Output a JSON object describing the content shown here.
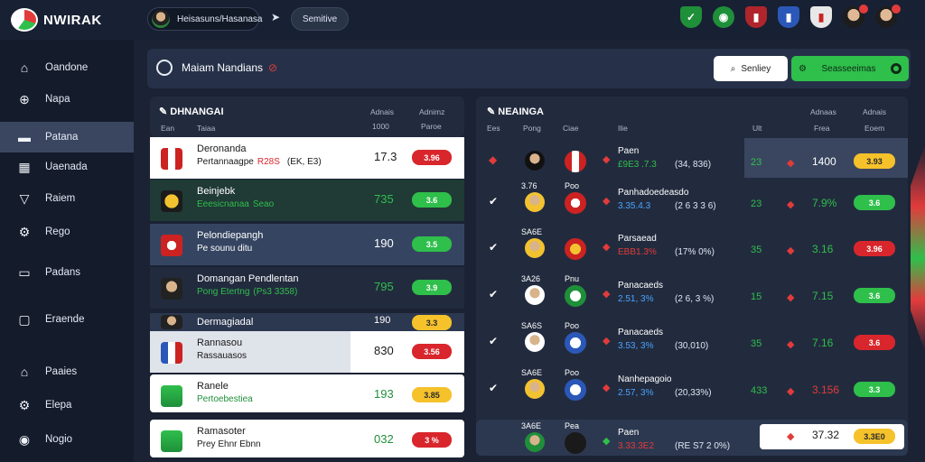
{
  "app": {
    "logo_text": "NWIRAK"
  },
  "topbar": {
    "user_label": "Heisasuns/Hasanasa",
    "service_label": "Semitive",
    "arrow_glyph": "➤"
  },
  "sidebar": {
    "items": [
      {
        "label": "Oandone",
        "icon": "home-icon",
        "glyph": "⌂"
      },
      {
        "label": "Napa",
        "icon": "compass-icon",
        "glyph": "⊕"
      },
      {
        "label": "Patana",
        "icon": "folder-icon",
        "glyph": "▬",
        "active": true
      },
      {
        "label": "Uaenada",
        "icon": "calendar-icon",
        "glyph": "▦"
      },
      {
        "label": "Raiem",
        "icon": "shield-icon",
        "glyph": "▽"
      },
      {
        "label": "Rego",
        "icon": "settings-icon",
        "glyph": "⚙"
      },
      {
        "label": "Padans",
        "icon": "document-icon",
        "glyph": "▭"
      },
      {
        "label": "Eraende",
        "icon": "square-icon",
        "glyph": "▢"
      },
      {
        "label": "Paaies",
        "icon": "house-icon",
        "glyph": "⌂"
      },
      {
        "label": "Elepa",
        "icon": "gear-icon",
        "glyph": "⚙"
      },
      {
        "label": "Nogio",
        "icon": "user-icon",
        "glyph": "◉"
      }
    ]
  },
  "header": {
    "title": "Maiam Nandians",
    "flag": "⊘"
  },
  "actions": {
    "search_label": "Senliey",
    "primary_label": "Seasseeimas"
  },
  "left_panel": {
    "title": "DHNANGAI",
    "columns": [
      "Ean",
      "Taiaa",
      "Adnais",
      "Adnimz",
      "1000",
      "Paroe"
    ],
    "rows": [
      {
        "name": "Deronanda",
        "sub": "Pertannaagpe",
        "sub_red": "R28S",
        "sub_tail": "(EK, E3)",
        "value": "17.3",
        "badge": "3.96",
        "badge_color": "red"
      },
      {
        "name": "Beinjebk",
        "sub": "Eeesicnanaa",
        "sub_tail": "Seao",
        "value": "735",
        "badge": "3.6",
        "badge_color": "green"
      },
      {
        "name": "Pelondiepangh",
        "sub": "Pe sounu ditu",
        "value": "190",
        "badge": "3.5",
        "badge_color": "green"
      },
      {
        "name": "Domangan Pendlentan",
        "sub": "Pong Etertng",
        "sub_tail": "(Ps3 3358)",
        "value": "795",
        "badge": "3.9",
        "badge_color": "green"
      },
      {
        "name": "Dermagiadal",
        "value": "190",
        "badge": "3.3",
        "badge_color": "yellow"
      },
      {
        "name": "Rannasou",
        "sub": "Rassauasos",
        "value": "830",
        "badge": "3.56",
        "badge_color": "red"
      },
      {
        "name": "Ranele",
        "sub": "Pertoebestiea",
        "value": "193",
        "badge": "3.85",
        "badge_color": "yellow"
      },
      {
        "name": "Ramasoter",
        "sub": "Prey Ehnr Ebnn",
        "value": "032",
        "badge": "3 %",
        "badge_color": "red"
      }
    ]
  },
  "right_panel": {
    "title": "NEAINGA",
    "columns": [
      "Ees",
      "Pong",
      "Ciae",
      "Ilie",
      "Ult",
      "Adnaas",
      "Adnais",
      "Frea",
      "Eoem"
    ],
    "rows": [
      {
        "check": "",
        "top": "",
        "crest_top": "",
        "bname": "Paen",
        "bval": "£9E3 .7.3",
        "bpar": "(34, 836)",
        "n1": "23",
        "n2": "1400",
        "badge": "3.93",
        "badge_color": "yellow"
      },
      {
        "check": "✔",
        "top": "3.76",
        "crest_top": "Poo",
        "bname": "Panhadoedeasdo",
        "bval": "3.35.4.3",
        "bpar": "(2 6 3 3 6)",
        "n1": "23",
        "n2": "7.9%",
        "badge": "3.6",
        "badge_color": "green"
      },
      {
        "check": "✔",
        "top": "SA6E",
        "crest_top": "",
        "bname": "Parsaead",
        "bval": "EBB1.3%",
        "bpar": "(17% 0%)",
        "n1": "35",
        "n2": "3.16",
        "badge": "3.96",
        "badge_color": "red"
      },
      {
        "check": "✔",
        "top": "3A26",
        "crest_top": "Pnu",
        "bname": "Panacaeds",
        "bval": "2.51, 3%",
        "bpar": "(2 6, 3 %)",
        "n1": "15",
        "n2": "7.15",
        "badge": "3.6",
        "badge_color": "green"
      },
      {
        "check": "✔",
        "top": "SA6S",
        "crest_top": "Poo",
        "bname": "Panacaeds",
        "bval": "3.53, 3%",
        "bpar": "(30,010)",
        "n1": "35",
        "n2": "7.16",
        "badge": "3.6",
        "badge_color": "red"
      },
      {
        "check": "✔",
        "top": "SA6E",
        "crest_top": "Poo",
        "bname": "Nanhepagoio",
        "bval": "2.57, 3%",
        "bpar": "(20,33%)",
        "n1": "433",
        "n2": "3.156",
        "badge": "3.3",
        "badge_color": "green"
      },
      {
        "check": "",
        "top": "3A6E",
        "crest_top": "Pea",
        "bname": "Paen",
        "bval": "3.33.3E2",
        "bpar": "(RE S7 2 0%)",
        "n1": "",
        "n2": "37.32",
        "badge": "3.3E0",
        "badge_color": "yellow"
      }
    ]
  },
  "colors": {
    "accent_red": "#e23b3b",
    "accent_green": "#2fbf4b",
    "accent_yellow": "#f5c22b",
    "bg": "#1a2234"
  }
}
